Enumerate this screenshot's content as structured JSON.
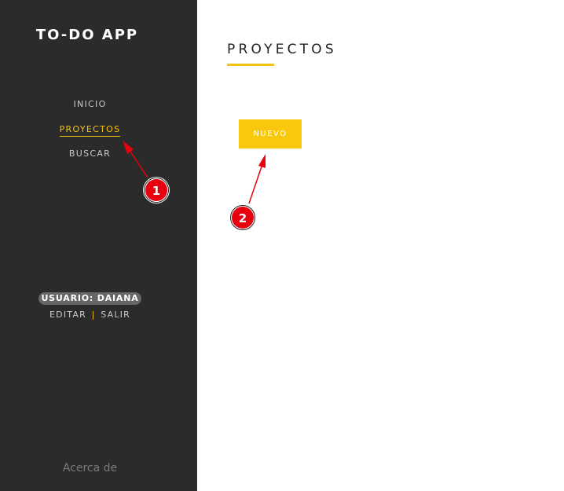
{
  "app": {
    "title": "TO-DO APP"
  },
  "sidebar": {
    "items": [
      {
        "label": "INICIO",
        "active": false
      },
      {
        "label": "PROYECTOS",
        "active": true
      },
      {
        "label": "BUSCAR",
        "active": false
      }
    ],
    "user_badge": "USUARIO: DAIANA",
    "edit_label": "EDITAR",
    "separator": "|",
    "logout_label": "SALIR",
    "about_label": "Acerca de"
  },
  "main": {
    "page_title": "PROYECTOS",
    "new_button_label": "NUEVO"
  },
  "annotations": [
    {
      "number": "1"
    },
    {
      "number": "2"
    }
  ],
  "colors": {
    "sidebar_bg": "#2b2b2b",
    "accent": "#f4c20d",
    "annotation_red": "#e8000e"
  }
}
